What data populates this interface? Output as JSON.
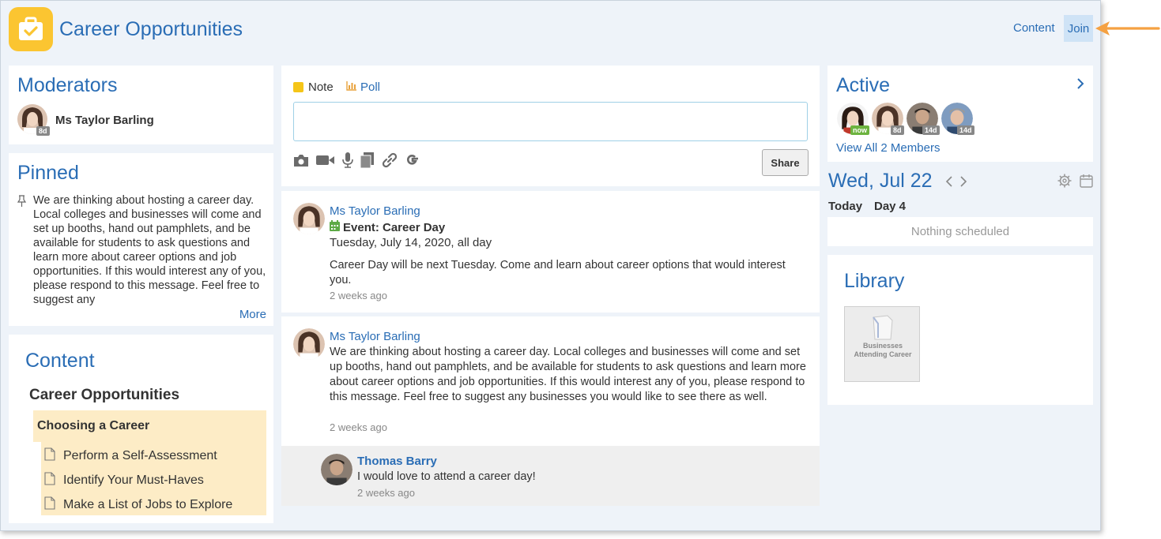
{
  "header": {
    "title": "Career Opportunities",
    "content_link": "Content",
    "join_button": "Join"
  },
  "moderators": {
    "title": "Moderators",
    "items": [
      {
        "name": "Ms Taylor Barling",
        "badge": "8d"
      }
    ]
  },
  "pinned": {
    "title": "Pinned",
    "text": "We are thinking about hosting a career day. Local colleges and businesses will come and set up booths, hand out pamphlets, and be available for students to ask questions and learn more about career options and job opportunities. If this would interest any of you, please respond to this message. Feel free to suggest any",
    "more": "More"
  },
  "content_panel": {
    "title": "Content",
    "course": "Career Opportunities",
    "section": "Choosing a Career",
    "pages": [
      "Perform a Self-Assessment",
      "Identify Your Must-Haves",
      "Make a List of Jobs to Explore"
    ]
  },
  "composer": {
    "note_tab": "Note",
    "poll_tab": "Poll",
    "input_value": "",
    "share_button": "Share"
  },
  "posts": [
    {
      "author": "Ms Taylor Barling",
      "event_label": "Event: Career Day",
      "event_date": "Tuesday, July 14, 2020, all day",
      "body": "Career Day will be next Tuesday. Come and learn about career options that would interest you.",
      "time": "2 weeks ago"
    },
    {
      "author": "Ms Taylor Barling",
      "body": "We are thinking about hosting a career day. Local colleges and businesses will come and set up booths, hand out pamphlets, and be available for students to ask questions and learn more about career options and job opportunities. If this would interest any of you, please respond to this message. Feel free to suggest any businesses you would like to see there as well.",
      "time": "2 weeks ago",
      "reply": {
        "author": "Thomas Barry",
        "body": "I would love to attend a career day!",
        "time": "2 weeks ago"
      }
    }
  ],
  "active": {
    "title": "Active",
    "badges": [
      "now",
      "8d",
      "14d",
      "14d"
    ],
    "view_all": "View All 2 Members"
  },
  "calendar": {
    "date": "Wed, Jul 22",
    "today": "Today",
    "day": "Day 4",
    "empty": "Nothing scheduled"
  },
  "library": {
    "title": "Library",
    "item": "Businesses Attending Career"
  },
  "colors": {
    "accent": "#2a6db5",
    "app_icon": "#fbc531",
    "tree_highlight": "#fdecc6",
    "badge_now": "#6cb33f"
  }
}
